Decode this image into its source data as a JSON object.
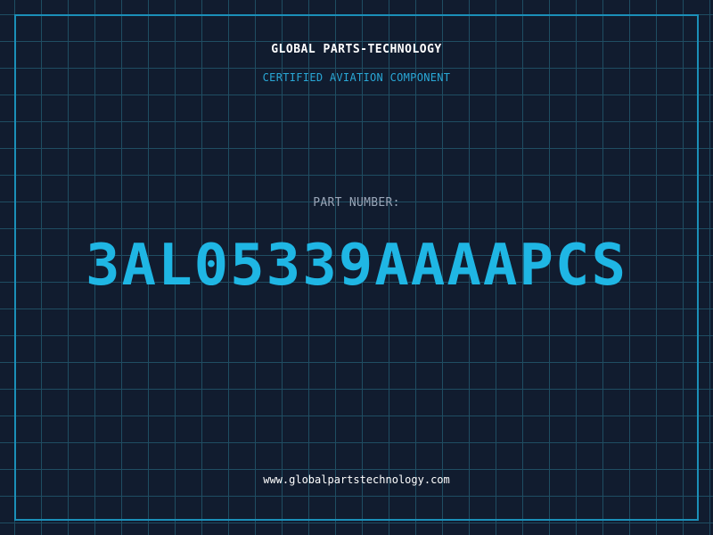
{
  "header": {
    "brand": "GLOBAL PARTS-TECHNOLOGY",
    "tagline": "CERTIFIED AVIATION COMPONENT"
  },
  "part": {
    "label": "PART NUMBER:",
    "number": "3AL05339AAAAPCS"
  },
  "footer": {
    "url": "www.globalpartstechnology.com"
  },
  "colors": {
    "background": "#111c2f",
    "grid": "#1f4d62",
    "frame": "#1b8fb8",
    "accent": "#1fb6e4",
    "tagline": "#29a7d6"
  }
}
